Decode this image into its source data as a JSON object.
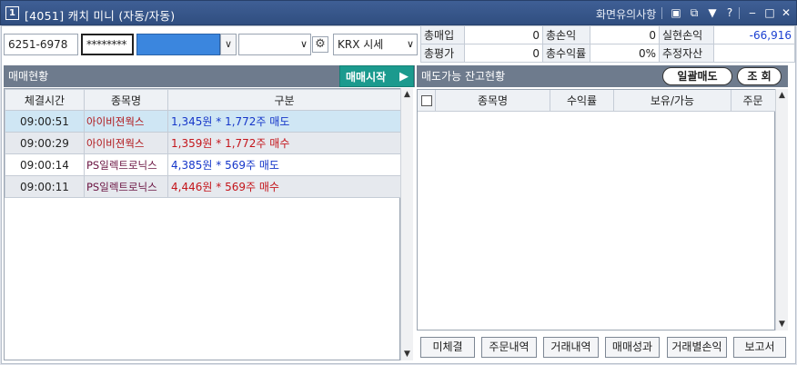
{
  "window": {
    "badge": "1",
    "title": "[4051] 캐치 미니 (자동/자동)",
    "notice": "화면유의사항",
    "icons": [
      "restore-icon",
      "window-icon",
      "pin-icon",
      "help-icon",
      "minimize-icon",
      "maximize-icon",
      "close-icon"
    ],
    "help_glyph": "?"
  },
  "controls": {
    "account": "6251-6978",
    "password_mask": "********",
    "account_name": "",
    "strategy": "",
    "market": "KRX 시세"
  },
  "summary": {
    "rows": [
      [
        {
          "label": "총매입",
          "value": "0"
        },
        {
          "label": "총손익",
          "value": "0"
        },
        {
          "label": "실현손익",
          "value": "-66,916"
        }
      ],
      [
        {
          "label": "총평가",
          "value": "0"
        },
        {
          "label": "총수익률",
          "value": "0%"
        },
        {
          "label": "추정자산",
          "value": ""
        }
      ]
    ]
  },
  "left_panel": {
    "title": "매매현황",
    "start_label": "매매시작",
    "columns": [
      "체결시간",
      "종목명",
      "구분"
    ],
    "rows": [
      {
        "time": "09:00:51",
        "name": "아이비젼웍스",
        "price": "1,345원",
        "sep": "*",
        "qty": "1,772주",
        "side": "매도"
      },
      {
        "time": "09:00:29",
        "name": "아이비젼웍스",
        "price": "1,359원",
        "sep": "*",
        "qty": "1,772주",
        "side": "매수"
      },
      {
        "time": "09:00:14",
        "name": "PS일렉트로닉스",
        "price": "4,385원",
        "sep": "*",
        "qty": "569주",
        "side": "매도"
      },
      {
        "time": "09:00:11",
        "name": "PS일렉트로닉스",
        "price": "4,446원",
        "sep": "*",
        "qty": "569주",
        "side": "매수"
      }
    ]
  },
  "right_panel": {
    "title": "매도가능 잔고현황",
    "sell_all_label": "일괄매도",
    "query_label": "조 회",
    "columns": [
      "종목명",
      "수익률",
      "보유/가능",
      "주문"
    ]
  },
  "bottom_buttons": [
    "미체결",
    "주문내역",
    "거래내역",
    "매매성과",
    "거래별손익",
    "보고서"
  ],
  "colors": {
    "title_bar": "#3a5a90",
    "section_header": "#6e7b8d",
    "start_button": "#1b9a8e",
    "sell_text": "#1536c9",
    "buy_text": "#c4151b",
    "selected_row": "#cfe6f4"
  }
}
